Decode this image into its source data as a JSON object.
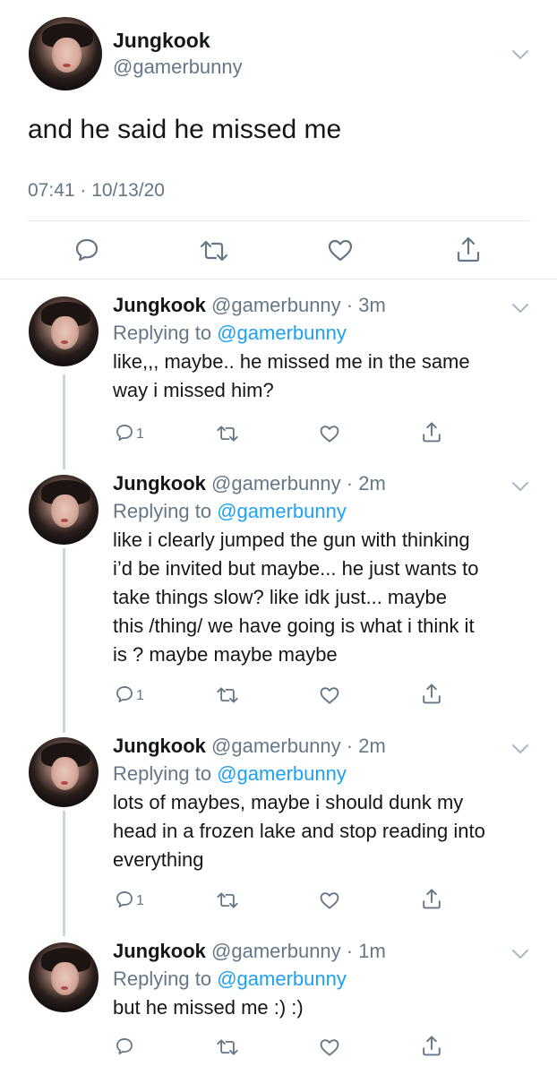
{
  "main": {
    "name": "Jungkook",
    "handle": "@gamerbunny",
    "text": "and he said he missed me",
    "timestamp": "07:41 · 10/13/20",
    "actions": [
      "reply-icon",
      "retweet-icon",
      "like-icon",
      "share-icon"
    ]
  },
  "replies": [
    {
      "name": "Jungkook",
      "meta": "@gamerbunny · 3m",
      "replying_prefix": "Replying to",
      "replying_to": "@gamerbunny",
      "text": "like,,, maybe.. he missed me in the same\nway i missed him?",
      "reply_count": "1"
    },
    {
      "name": "Jungkook",
      "meta": "@gamerbunny · 2m",
      "replying_prefix": "Replying to",
      "replying_to": "@gamerbunny",
      "text": "like i clearly jumped the gun with thinking\ni’d be invited but maybe... he just wants to\ntake things slow? like idk just... maybe\nthis /thing/ we have going is what i think it\nis ? maybe maybe maybe",
      "reply_count": "1"
    },
    {
      "name": "Jungkook",
      "meta": "@gamerbunny · 2m",
      "replying_prefix": "Replying to",
      "replying_to": "@gamerbunny",
      "text": "lots of maybes, maybe i should dunk my\nhead in a frozen lake and stop reading into\neverything",
      "reply_count": "1"
    },
    {
      "name": "Jungkook",
      "meta": "@gamerbunny · 1m",
      "replying_prefix": "Replying to",
      "replying_to": "@gamerbunny",
      "text": "but he missed me :) :)",
      "reply_count": ""
    }
  ],
  "colors": {
    "text": "#14171a",
    "secondary": "#657786",
    "link": "#1da1f2",
    "divider": "#e1e8ed",
    "thread_line": "#ccd6dd"
  }
}
